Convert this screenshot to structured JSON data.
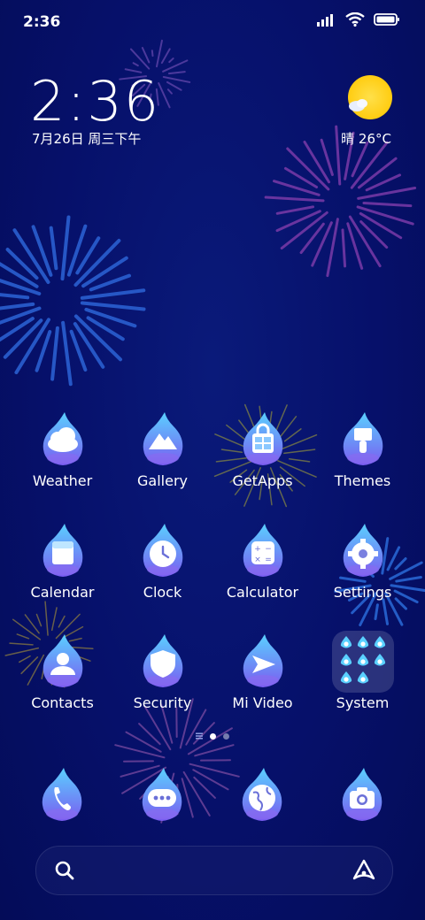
{
  "status_bar": {
    "time": "2:36",
    "icons": [
      "signal-icon",
      "wifi-icon",
      "battery-icon"
    ]
  },
  "lock_widget": {
    "time": "2:36",
    "date": "7月26日 周三下午",
    "weather": "晴 26°C",
    "weather_icon": "sunny-icon"
  },
  "apps": [
    {
      "label": "Weather",
      "icon": "cloud-icon"
    },
    {
      "label": "Gallery",
      "icon": "mountain-icon"
    },
    {
      "label": "GetApps",
      "icon": "shopping-bag-icon"
    },
    {
      "label": "Themes",
      "icon": "brush-icon"
    },
    {
      "label": "Calendar",
      "icon": "calendar-icon"
    },
    {
      "label": "Clock",
      "icon": "clock-icon"
    },
    {
      "label": "Calculator",
      "icon": "calculator-icon"
    },
    {
      "label": "Settings",
      "icon": "gear-icon"
    },
    {
      "label": "Contacts",
      "icon": "person-icon"
    },
    {
      "label": "Security",
      "icon": "shield-icon"
    },
    {
      "label": "Mi Video",
      "icon": "play-icon"
    },
    {
      "label": "System",
      "icon": "folder-icon"
    }
  ],
  "page_indicator": {
    "pages": 2,
    "current": 1
  },
  "dock": [
    {
      "icon": "phone-icon"
    },
    {
      "icon": "message-icon"
    },
    {
      "icon": "browser-icon"
    },
    {
      "icon": "camera-icon"
    }
  ],
  "search": {
    "left_icon": "search-icon",
    "right_icon": "assistant-icon"
  },
  "colors": {
    "background": "#06106a",
    "flame_top": "#5ad0ff",
    "flame_bottom": "#7a5cf0",
    "sun": "#ffd21f"
  }
}
